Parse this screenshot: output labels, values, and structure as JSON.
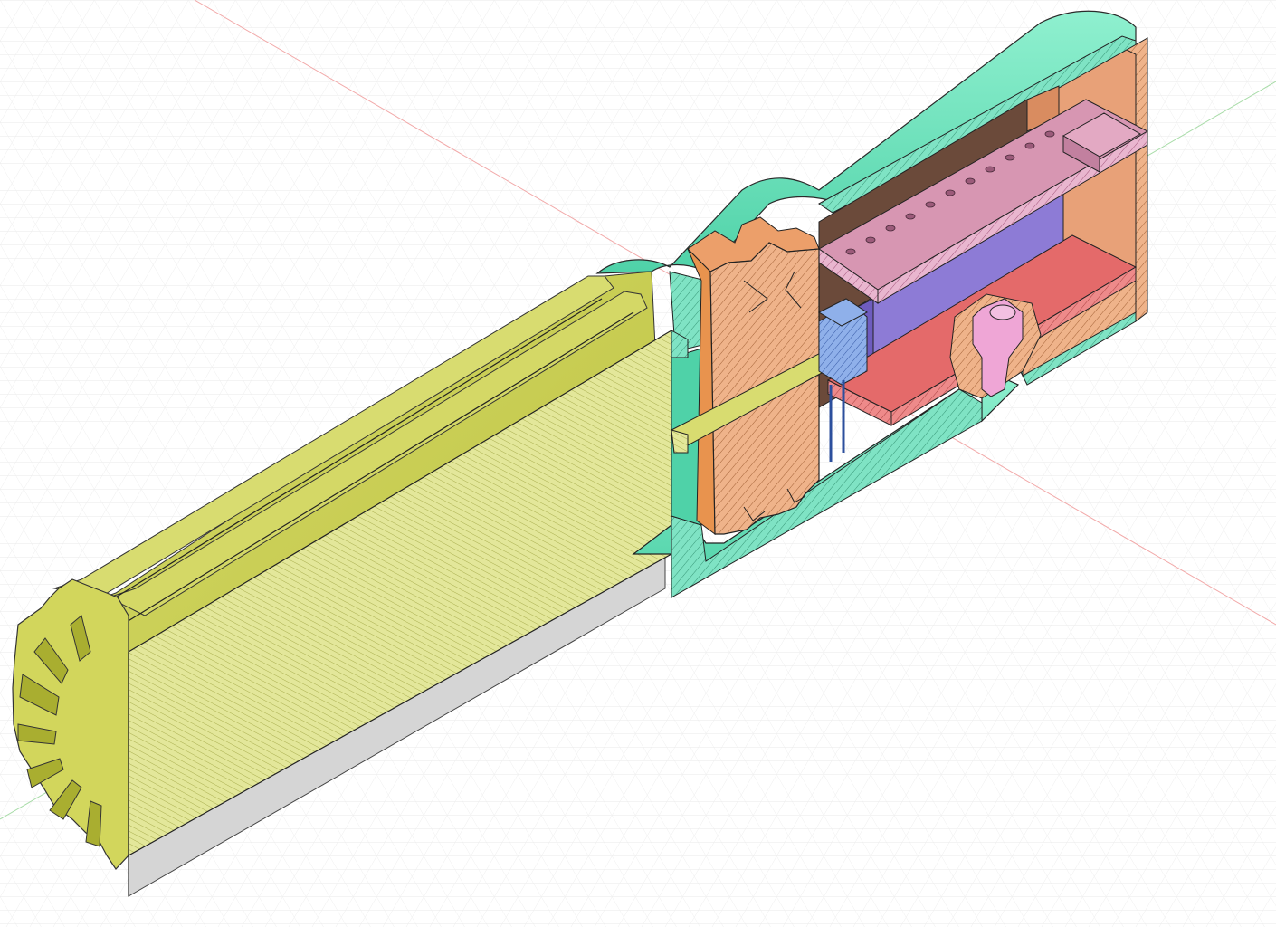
{
  "viewport": {
    "background": "#ffffff",
    "grid_color": "#e3e3e3",
    "axis_x_color": "#f2a9a9",
    "axis_y_color": "#a8dca8"
  },
  "model": {
    "parts": [
      {
        "name": "grip-handle",
        "color": "#cfd35a",
        "section_color": "#e6e99c"
      },
      {
        "name": "outer-housing",
        "color": "#6ee6bf",
        "section_color": "#7fe3c4"
      },
      {
        "name": "gear-block",
        "color": "#ecab7f"
      },
      {
        "name": "end-cap",
        "color": "#e8a178"
      },
      {
        "name": "pin-header-board",
        "color": "#d796b2"
      },
      {
        "name": "module",
        "color": "#8d7bd6"
      },
      {
        "name": "circuit-board",
        "color": "#e46a6a"
      },
      {
        "name": "capacitor",
        "color": "#6b8ed8"
      },
      {
        "name": "push-button",
        "color": "#efa6d6"
      }
    ]
  }
}
